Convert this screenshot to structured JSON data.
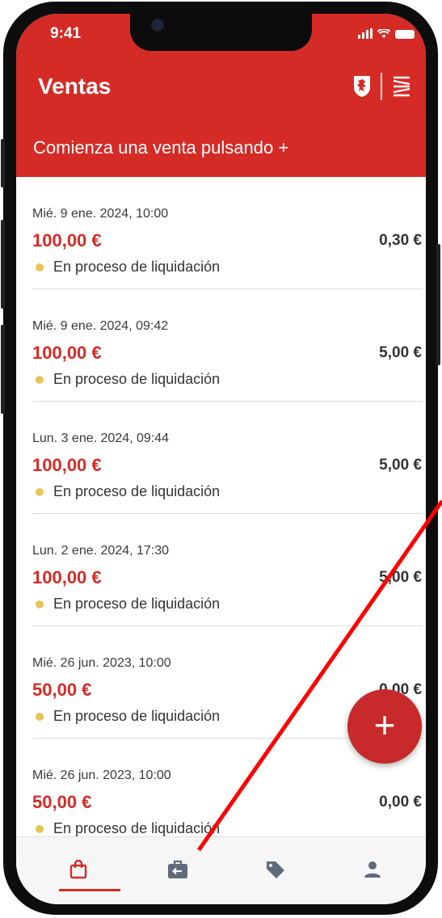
{
  "status_bar": {
    "time": "9:41"
  },
  "header": {
    "title": "Ventas"
  },
  "banner": {
    "text": "Comienza una venta pulsando +"
  },
  "sales": [
    {
      "date": "Mié. 9 ene. 2024, 10:00",
      "amount": "100,00 €",
      "commission": "0,30 €",
      "status": "En proceso de liquidación"
    },
    {
      "date": "Mié. 9 ene. 2024, 09:42",
      "amount": "100,00 €",
      "commission": "5,00 €",
      "status": "En proceso de liquidación"
    },
    {
      "date": "Lun. 3 ene. 2024, 09:44",
      "amount": "100,00 €",
      "commission": "5,00 €",
      "status": "En proceso de liquidación"
    },
    {
      "date": "Lun. 2 ene. 2024, 17:30",
      "amount": "100,00 €",
      "commission": "5,00 €",
      "status": "En proceso de liquidación"
    },
    {
      "date": "Mié. 26 jun. 2023, 10:00",
      "amount": "50,00 €",
      "commission": "0,00 €",
      "status": "En proceso de liquidación"
    },
    {
      "date": "Mié. 26 jun. 2023, 10:00",
      "amount": "50,00 €",
      "commission": "0,00 €",
      "status": "En proceso de liquidación"
    }
  ],
  "fab": {
    "label": "+"
  },
  "tabs": [
    {
      "icon": "shopping-bag-icon",
      "active": true
    },
    {
      "icon": "briefcase-return-icon",
      "active": false
    },
    {
      "icon": "tag-icon",
      "active": false
    },
    {
      "icon": "user-icon",
      "active": false
    }
  ],
  "colors": {
    "brand_red": "#d52b26",
    "status_pending": "#e8c45a",
    "tab_inactive": "#5f6b7a",
    "annotation": "#ff0000"
  }
}
